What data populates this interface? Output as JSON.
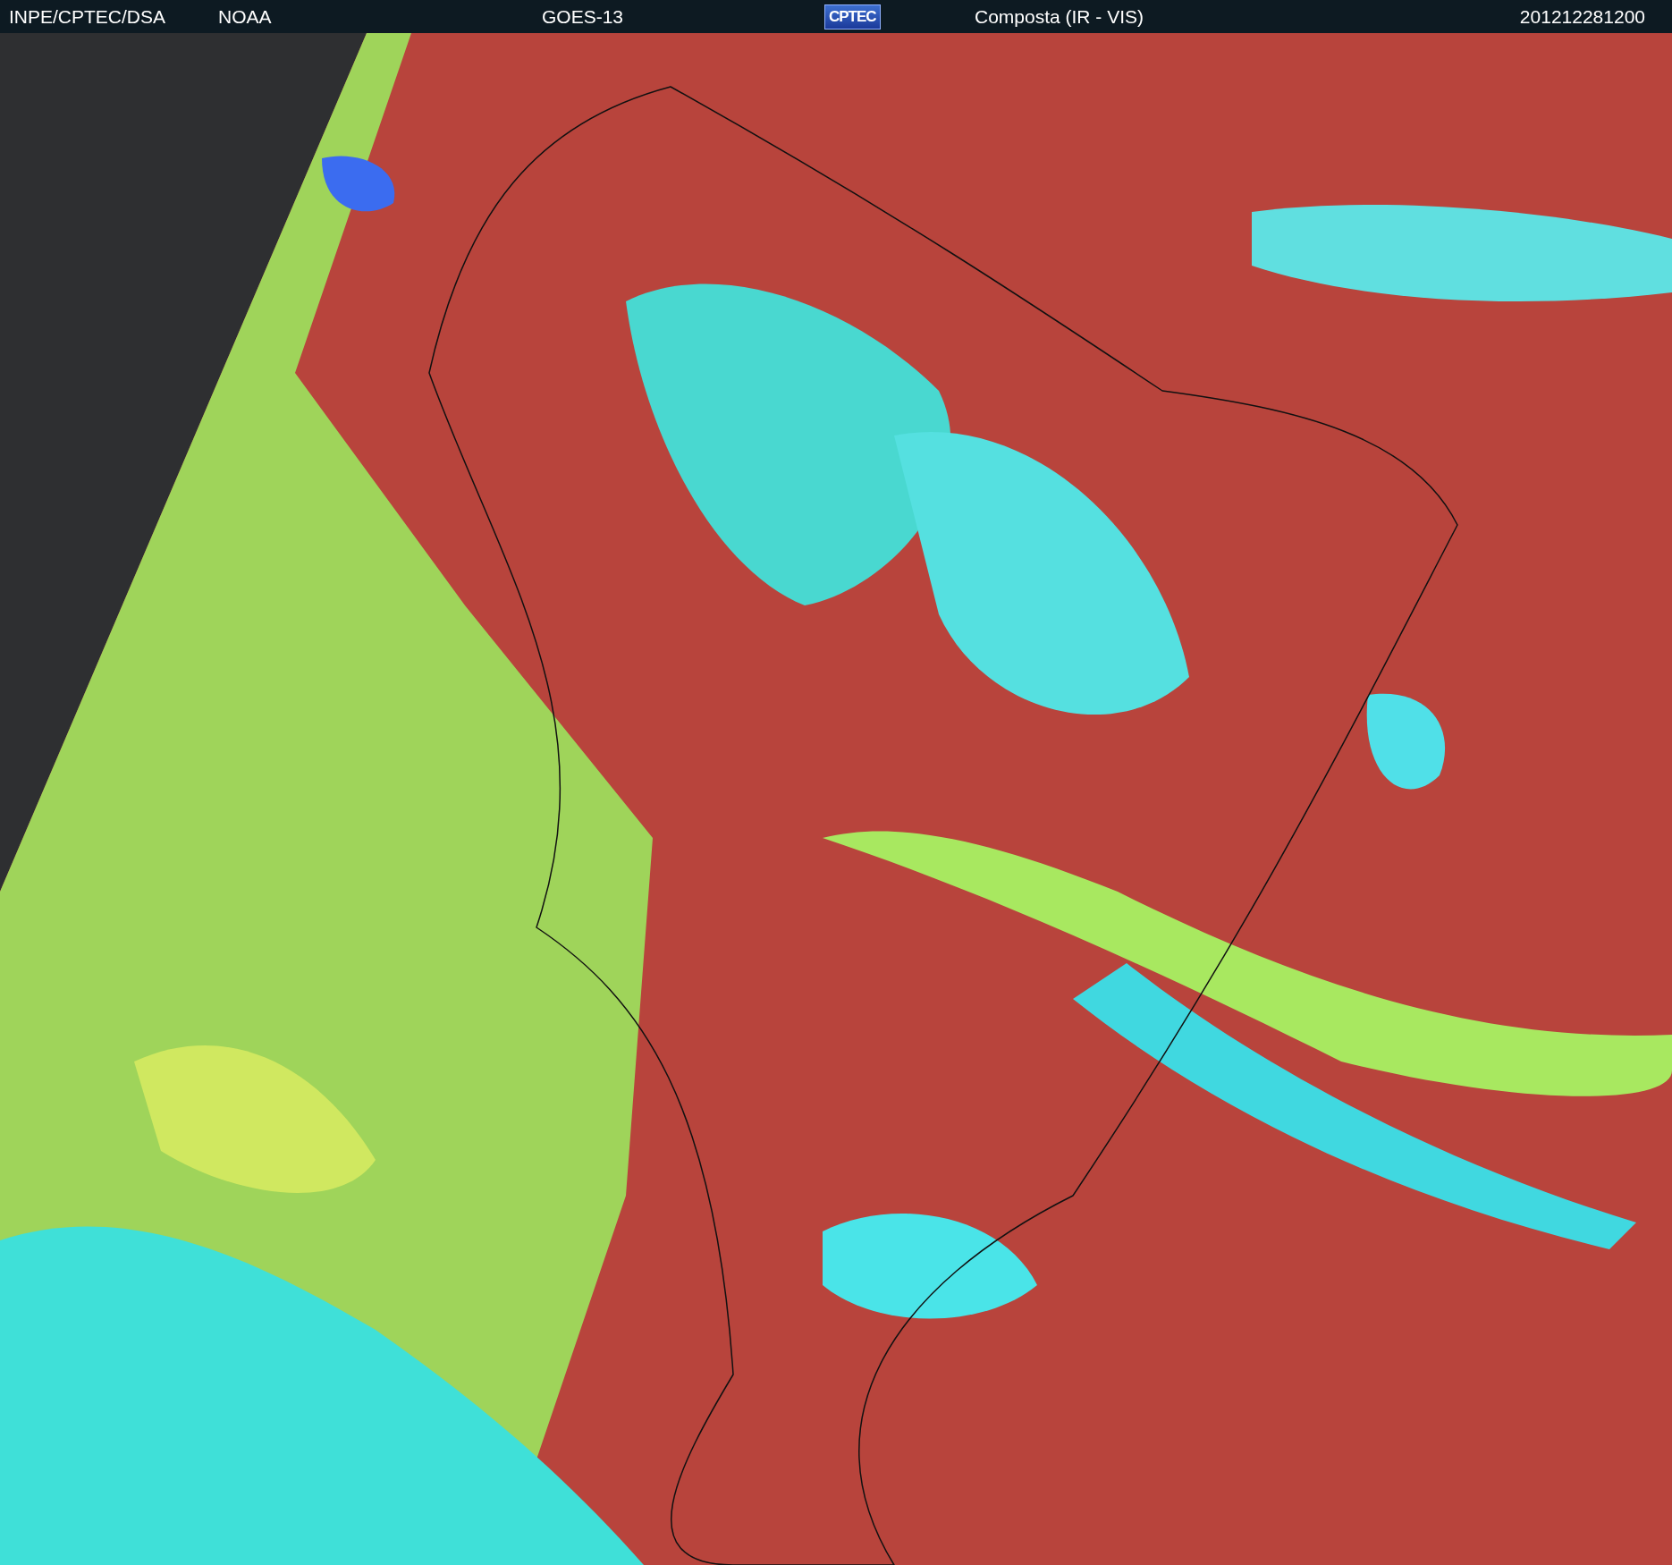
{
  "header": {
    "source": "INPE/CPTEC/DSA",
    "agency": "NOAA",
    "satellite": "GOES-13",
    "logo": "CPTEC",
    "product": "Composta (IR - VIS)",
    "timestamp": "201212281200"
  }
}
